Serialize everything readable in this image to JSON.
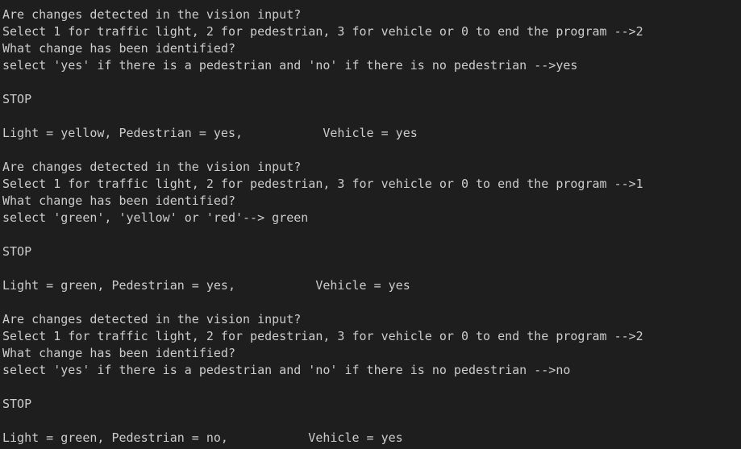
{
  "terminal": {
    "lines": [
      "Are changes detected in the vision input?",
      "Select 1 for traffic light, 2 for pedestrian, 3 for vehicle or 0 to end the program -->2",
      "What change has been identified?",
      "select 'yes' if there is a pedestrian and 'no' if there is no pedestrian -->yes",
      "",
      "STOP",
      "",
      "Light = yellow, Pedestrian = yes,           Vehicle = yes",
      "",
      "Are changes detected in the vision input?",
      "Select 1 for traffic light, 2 for pedestrian, 3 for vehicle or 0 to end the program -->1",
      "What change has been identified?",
      "select 'green', 'yellow' or 'red'--> green",
      "",
      "STOP",
      "",
      "Light = green, Pedestrian = yes,           Vehicle = yes",
      "",
      "Are changes detected in the vision input?",
      "Select 1 for traffic light, 2 for pedestrian, 3 for vehicle or 0 to end the program -->2",
      "What change has been identified?",
      "select 'yes' if there is a pedestrian and 'no' if there is no pedestrian -->no",
      "",
      "STOP",
      "",
      "Light = green, Pedestrian = no,           Vehicle = yes"
    ]
  }
}
